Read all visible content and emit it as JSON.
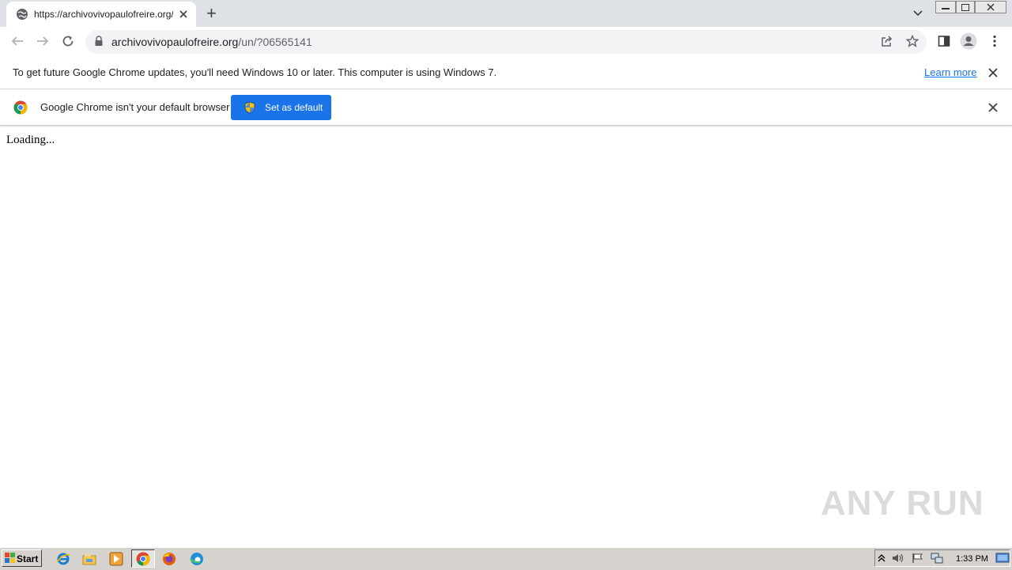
{
  "tab": {
    "title": "https://archivovivopaulofreire.org/u",
    "new_tab_symbol": "+"
  },
  "toolbar": {
    "url_host": "archivovivopaulofreire.org",
    "url_path": "/un/?06565141"
  },
  "infobar_update": {
    "message": "To get future Google Chrome updates, you'll need Windows 10 or later. This computer is using Windows 7.",
    "link": "Learn more"
  },
  "infobar_default": {
    "message": "Google Chrome isn't your default browser",
    "button": "Set as default"
  },
  "content": {
    "loading_text": "Loading..."
  },
  "watermark": {
    "text": "ANY RUN"
  },
  "taskbar": {
    "start_label": "Start",
    "clock": "1:33 PM",
    "pinned": [
      "ie-icon",
      "explorer-icon",
      "media-player-icon",
      "chrome-icon",
      "firefox-icon",
      "edge-icon"
    ]
  },
  "colors": {
    "accent": "#1a73e8",
    "tab_strip": "#dee1e6",
    "taskbar": "#d6d3ce"
  }
}
